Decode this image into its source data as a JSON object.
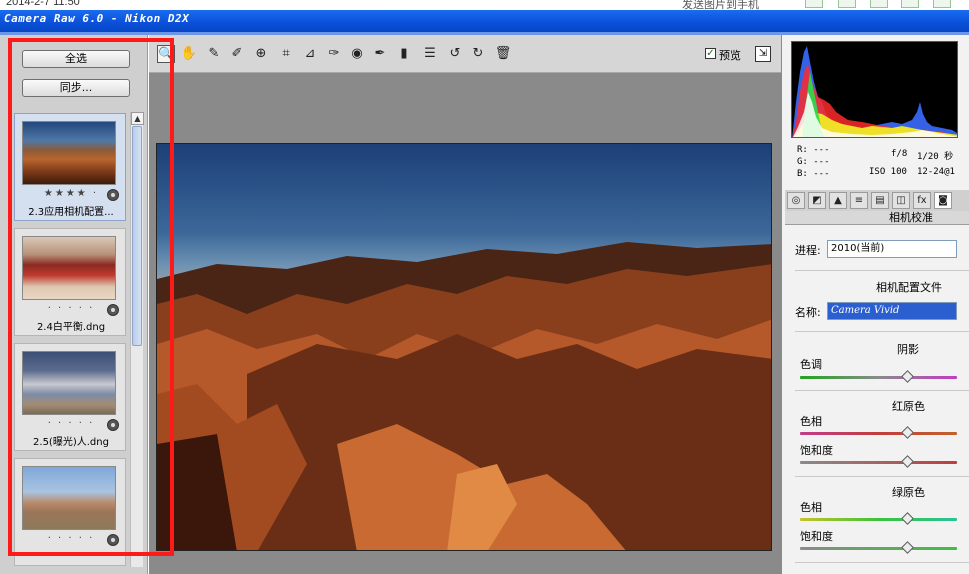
{
  "topbar": {
    "datetime": "2014-2-7 11:50",
    "right_label": "发送图片到手机"
  },
  "window": {
    "title": "Camera Raw 6.0 -  Nikon D2X"
  },
  "filmstrip": {
    "select_all": "全选",
    "sync": "同步...",
    "items": [
      {
        "label": "2.3应用相机配置...",
        "rating": "★★★★ ·",
        "selected": true
      },
      {
        "label": "2.4白平衡.dng",
        "rating": "· · · · ·",
        "selected": false
      },
      {
        "label": "2.5(曝光)人.dng",
        "rating": "· · · · ·",
        "selected": false
      },
      {
        "label": "",
        "rating": "· · · · ·",
        "selected": false
      }
    ]
  },
  "toolbar": {
    "tools": [
      {
        "name": "zoom-tool-icon",
        "glyph": "🔍"
      },
      {
        "name": "hand-tool-icon",
        "glyph": "✋"
      },
      {
        "name": "white-balance-tool-icon",
        "glyph": "✎"
      },
      {
        "name": "color-sampler-tool-icon",
        "glyph": "✐"
      },
      {
        "name": "targeted-adjustment-tool-icon",
        "glyph": "⊕"
      },
      {
        "name": "crop-tool-icon",
        "glyph": "⌗"
      },
      {
        "name": "straighten-tool-icon",
        "glyph": "⊿"
      },
      {
        "name": "spot-removal-tool-icon",
        "glyph": "✑"
      },
      {
        "name": "red-eye-tool-icon",
        "glyph": "◉"
      },
      {
        "name": "adjustment-brush-icon",
        "glyph": "✒"
      },
      {
        "name": "graduated-filter-icon",
        "glyph": "▮"
      },
      {
        "name": "preferences-icon",
        "glyph": "☰"
      },
      {
        "name": "rotate-ccw-icon",
        "glyph": "↺"
      },
      {
        "name": "rotate-cw-icon",
        "glyph": "↻"
      },
      {
        "name": "delete-icon",
        "glyph": "🗑"
      }
    ],
    "preview_label": "预览",
    "preview_checked": "✓"
  },
  "readout": {
    "r": "R:  ---",
    "g": "G:  ---",
    "b": "B:  ---",
    "aperture": "f/8",
    "shutter": "1/20 秒",
    "iso": "ISO 100",
    "lens": "12-24@1"
  },
  "panel": {
    "title": "相机校准",
    "process_label": "进程:",
    "process_value": "2010(当前)",
    "profile_section": "相机配置文件",
    "name_label": "名称:",
    "name_value": "Camera Vivid",
    "shadows_title": "阴影",
    "tint_label": "色调",
    "red_title": "红原色",
    "red_hue_label": "色相",
    "red_sat_label": "饱和度",
    "green_title": "绿原色",
    "green_hue_label": "色相",
    "green_sat_label": "饱和度",
    "tabs": [
      "◎",
      "◩",
      "▲",
      "≡",
      "▤",
      "◫",
      "fx",
      "◙"
    ]
  }
}
